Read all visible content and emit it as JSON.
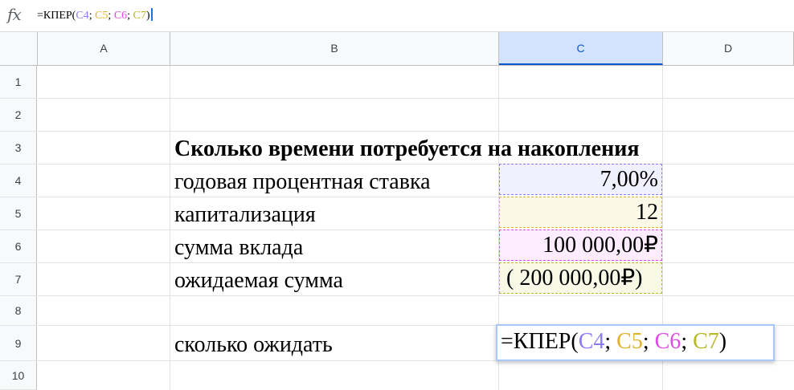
{
  "formula_bar": {
    "fx_label": "fx",
    "prefix": "=КПЕР(",
    "refs": [
      "C4",
      "C5",
      "C6",
      "C7"
    ],
    "sep": "; ",
    "suffix": ")"
  },
  "columns": [
    "A",
    "B",
    "C",
    "D"
  ],
  "active_column": "C",
  "rows": [
    "1",
    "2",
    "3",
    "4",
    "5",
    "6",
    "7",
    "8",
    "9",
    "10"
  ],
  "cells": {
    "B3": "Сколько времени потребуется на накопления",
    "B4": "годовая процентная ставка",
    "B5": "капитализация",
    "B6": "сумма вклада",
    "B7": "ожидаемая сумма",
    "B9": "сколько ожидать",
    "C4": "7,00%",
    "C5": "12",
    "C6": "100 000,00₽",
    "C7": "( 200 000,00₽)"
  },
  "editor": {
    "prefix": "=КПЕР(",
    "refs": [
      "C4",
      "C5",
      "C6",
      "C7"
    ],
    "sep": "; ",
    "suffix": ")"
  },
  "colors": {
    "C4": "#8b7cf5",
    "C5": "#e3b22c",
    "C6": "#e04ae8",
    "C7": "#b6b826",
    "selection": "#0b57d0"
  }
}
